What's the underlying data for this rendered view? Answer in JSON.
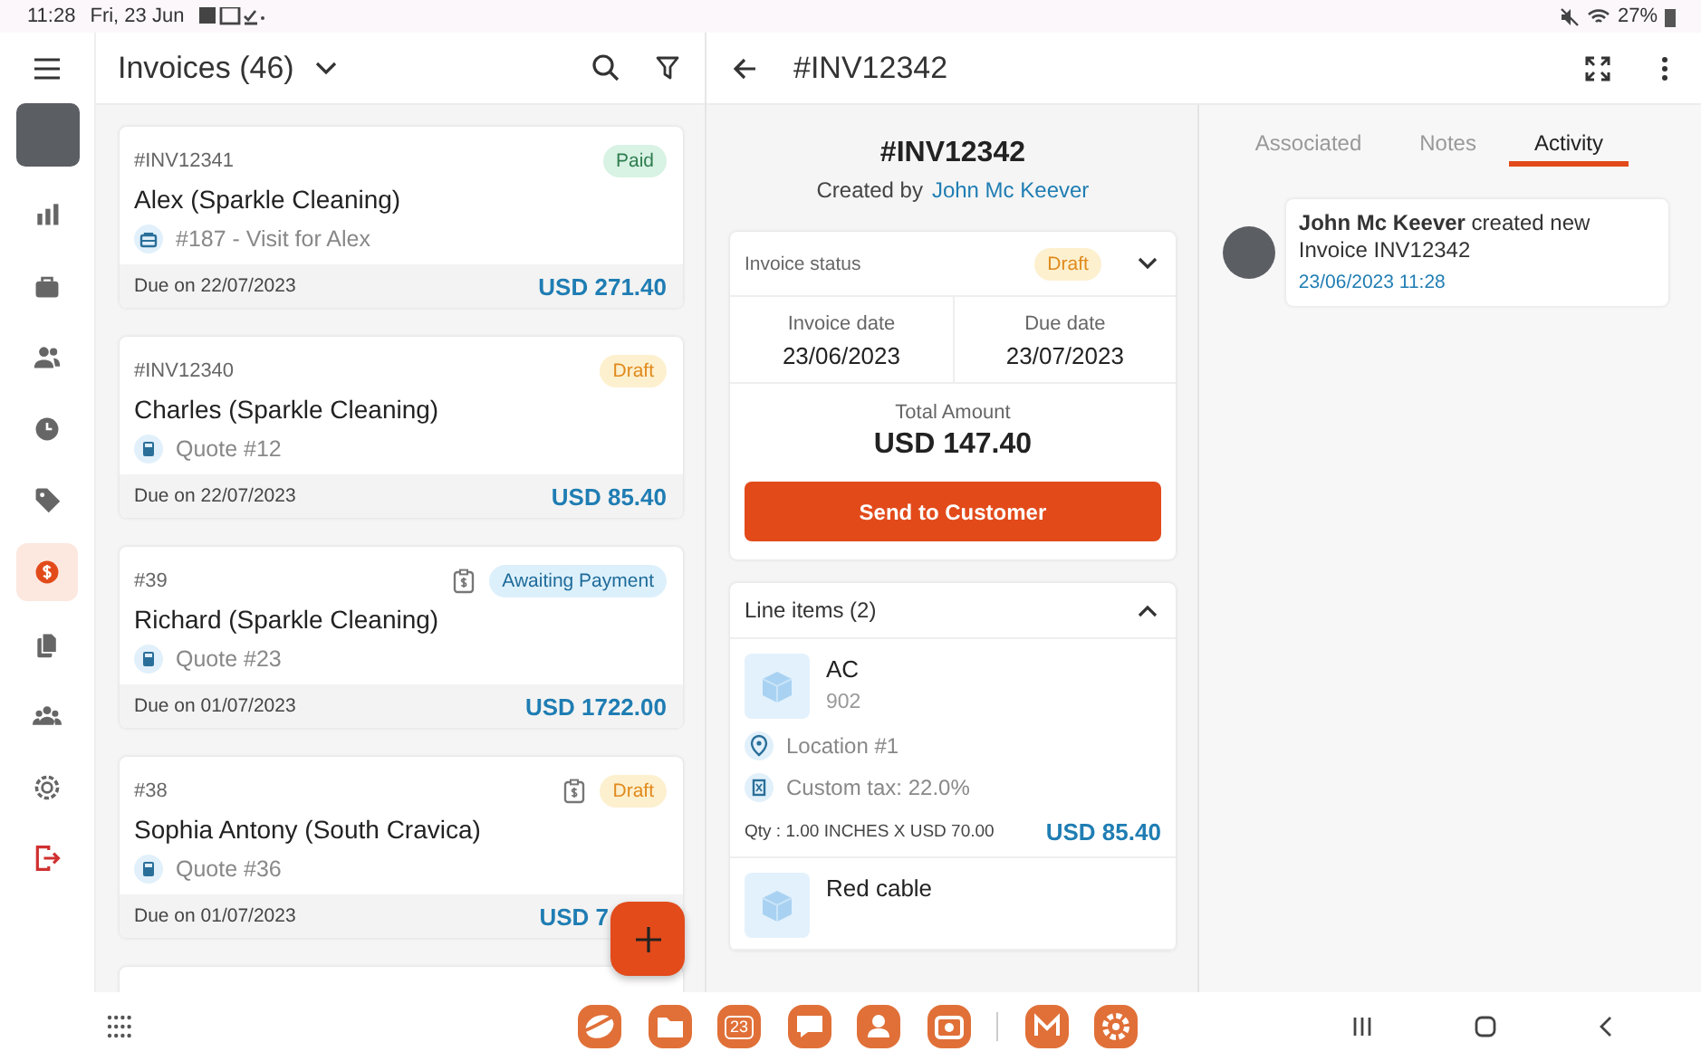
{
  "status_bar": {
    "time": "11:28",
    "date": "Fri, 23 Jun",
    "battery": "27%"
  },
  "sidebar": {
    "items": [
      {
        "kind": "chart",
        "selected": false
      },
      {
        "kind": "briefcase",
        "selected": false
      },
      {
        "kind": "people",
        "selected": false
      },
      {
        "kind": "clock",
        "selected": false
      },
      {
        "kind": "tag",
        "selected": false
      },
      {
        "kind": "dollar",
        "selected": true
      },
      {
        "kind": "documents",
        "selected": false
      },
      {
        "kind": "group",
        "selected": false
      },
      {
        "kind": "gear",
        "selected": false
      },
      {
        "kind": "logout",
        "selected": false
      }
    ]
  },
  "list": {
    "title": "Invoices (46)",
    "cards": [
      {
        "number": "#INV12341",
        "badge": {
          "text": "Paid",
          "kind": "paid"
        },
        "receipt_icon": false,
        "name": "Alex (Sparkle Cleaning)",
        "link": {
          "text": "#187 - Visit for Alex",
          "kind": "job"
        },
        "due": "Due on 22/07/2023",
        "amount": "USD 271.40"
      },
      {
        "number": "#INV12340",
        "badge": {
          "text": "Draft",
          "kind": "draft"
        },
        "receipt_icon": false,
        "name": "Charles (Sparkle Cleaning)",
        "link": {
          "text": "Quote #12",
          "kind": "quote"
        },
        "due": "Due on 22/07/2023",
        "amount": "USD 85.40"
      },
      {
        "number": "#39",
        "badge": {
          "text": "Awaiting Payment",
          "kind": "awaiting"
        },
        "receipt_icon": true,
        "name": "Richard (Sparkle Cleaning)",
        "link": {
          "text": "Quote #23",
          "kind": "quote"
        },
        "due": "Due on 01/07/2023",
        "amount": "USD 1722.00"
      },
      {
        "number": "#38",
        "badge": {
          "text": "Draft",
          "kind": "draft"
        },
        "receipt_icon": true,
        "name": "Sophia Antony (South Cravica)",
        "link": {
          "text": "Quote #36",
          "kind": "quote"
        },
        "due": "Due on 01/07/2023",
        "amount": "USD 7"
      }
    ]
  },
  "detail": {
    "header": "#INV12342",
    "number": "#INV12342",
    "created_by_label": "Created by",
    "created_by": "John Mc Keever",
    "status_label": "Invoice status",
    "status": {
      "text": "Draft",
      "kind": "draft"
    },
    "invoice_date_label": "Invoice date",
    "invoice_date": "23/06/2023",
    "due_date_label": "Due date",
    "due_date": "23/07/2023",
    "total_label": "Total Amount",
    "total": "USD 147.40",
    "send_button": "Send to Customer",
    "line_items": {
      "title": "Line items (2)",
      "expanded": true,
      "items": [
        {
          "name": "AC",
          "code": "902",
          "location": "Location #1",
          "tax": "Custom tax: 22.0%",
          "qty": "Qty : 1.00 INCHES X USD 70.00",
          "amount": "USD 85.40"
        },
        {
          "name": "Red cable"
        }
      ]
    }
  },
  "tabs": [
    {
      "label": "Associated",
      "selected": false
    },
    {
      "label": "Notes",
      "selected": false
    },
    {
      "label": "Activity",
      "selected": true
    }
  ],
  "activity": [
    {
      "text": "**John Mc Keever** created new Invoice INV12342",
      "time": "23/06/2023 11:28"
    }
  ],
  "nav_bar": {
    "calendar_day": "23"
  }
}
